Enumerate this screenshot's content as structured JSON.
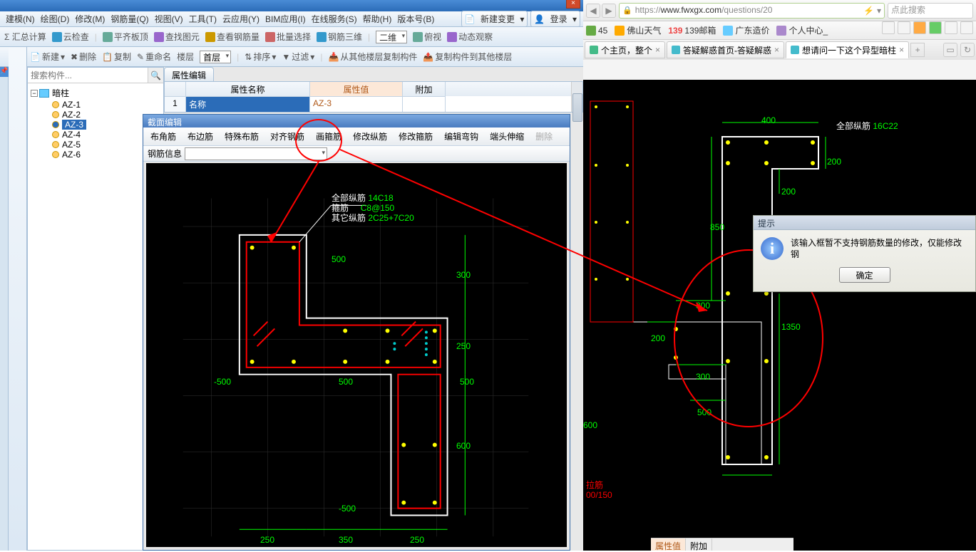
{
  "menubar": {
    "items": [
      "建模(N)",
      "绘图(D)",
      "修改(M)",
      "钢筋量(Q)",
      "视图(V)",
      "工具(T)",
      "云应用(Y)",
      "BIM应用(I)",
      "在线服务(S)",
      "帮助(H)",
      "版本号(B)"
    ],
    "new_change": "新建变更",
    "login": "登录"
  },
  "toolbar1": {
    "sum": "Σ 汇总计算",
    "cloud": "云检查",
    "flat": "平齐板顶",
    "find": "查找图元",
    "rebar": "查看钢筋量",
    "batch": "批量选择",
    "rebar3d": "钢筋三维",
    "view3d": "二维",
    "bird": "俯视",
    "dyn": "动态观察"
  },
  "toolbar2": {
    "new": "新建",
    "del": "删除",
    "copy": "复制",
    "rename": "重命名",
    "floor": "楼层",
    "first": "首层",
    "sort": "排序",
    "filter": "过滤",
    "copy_from": "从其他楼层复制构件",
    "copy_to": "复制构件到其他楼层"
  },
  "tree": {
    "search_ph": "搜索构件...",
    "root": "暗柱",
    "items": [
      "AZ-1",
      "AZ-2",
      "AZ-3",
      "AZ-4",
      "AZ-5",
      "AZ-6"
    ],
    "selected": "AZ-3"
  },
  "prop": {
    "tab": "属性编辑",
    "col_name": "属性名称",
    "col_value": "属性值",
    "col_extra": "附加",
    "row1_name": "名称",
    "row1_value": "AZ-3",
    "row1_num": "1"
  },
  "section": {
    "title": "截面编辑",
    "tools": [
      "布角筋",
      "布边筋",
      "特殊布筋",
      "对齐钢筋",
      "画箍筋",
      "修改纵筋",
      "修改箍筋",
      "编辑弯钩",
      "端头伸缩",
      "删除"
    ],
    "info_label": "钢筋信息",
    "labels": {
      "all": "全部纵筋",
      "all_v": "14C18",
      "hoop": "箍筋",
      "hoop_v": "C8@150",
      "other": "其它纵筋",
      "other_v": "2C25+7C20"
    },
    "dims": {
      "d300": "300",
      "d250": "250",
      "d500": "500",
      "d600": "600",
      "dn500": "-500",
      "d350": "350"
    }
  },
  "browser": {
    "url_prefix": "https://",
    "url_domain": "www.fwxgx.com",
    "url_rest": "/questions/20",
    "search_ph": "点此搜索",
    "bookmarks": [
      {
        "label": "45",
        "color": "#6a4"
      },
      {
        "label": "佛山天气",
        "color": "#fa0"
      },
      {
        "label": "139邮箱",
        "color": "#e44"
      },
      {
        "label": "广东造价",
        "color": "#6cf"
      },
      {
        "label": "个人中心_",
        "color": "#a8c"
      }
    ],
    "tabs": [
      {
        "label": "个主页，整个",
        "icon": "#4b8"
      },
      {
        "label": "答疑解惑首页-答疑解惑",
        "icon": "#4bc"
      },
      {
        "label": "想请问一下这个异型暗柱",
        "icon": "#4bc",
        "active": true
      }
    ]
  },
  "browser_cad": {
    "all_label": "全部纵筋",
    "all_val": "16C22",
    "d400": "400",
    "d200": "200",
    "d850": "850",
    "d300": "300",
    "d1350": "1350",
    "d500": "500",
    "d600": "600",
    "d150": "00/150",
    "lj": "拉筋"
  },
  "msgbox": {
    "title": "提示",
    "text": "该输入框暂不支持钢筋数量的修改，仅能修改钢",
    "ok": "确定"
  },
  "bottom": {
    "val": "属性值",
    "extra": "附加"
  }
}
